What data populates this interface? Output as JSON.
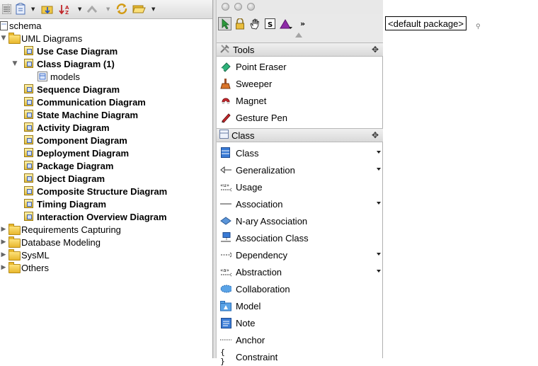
{
  "left_toolbar": {
    "icons": [
      "menu-icon",
      "refresh-diagram-icon",
      "folder-down-icon",
      "sort-az-icon",
      "up-arrow-icon",
      "sync-icon",
      "folder-open-icon"
    ]
  },
  "tree": {
    "root": "schema",
    "uml_folder": "UML Diagrams",
    "uml_children": [
      {
        "label": "Use Case Diagram"
      },
      {
        "label": "Class Diagram (1)"
      },
      {
        "label": "models"
      },
      {
        "label": "Sequence Diagram"
      },
      {
        "label": "Communication Diagram"
      },
      {
        "label": "State Machine Diagram"
      },
      {
        "label": "Activity Diagram"
      },
      {
        "label": "Component Diagram"
      },
      {
        "label": "Deployment Diagram"
      },
      {
        "label": "Package Diagram"
      },
      {
        "label": "Object Diagram"
      },
      {
        "label": "Composite Structure Diagram"
      },
      {
        "label": "Timing Diagram"
      },
      {
        "label": "Interaction Overview Diagram"
      }
    ],
    "folders": [
      "Requirements Capturing",
      "Database Modeling",
      "SysML",
      "Others"
    ]
  },
  "palette": {
    "toolbar_icons": [
      "select-arrow-icon",
      "lock-icon",
      "hand-icon",
      "s-icon",
      "triangle-icon",
      "expand-chevron-icon"
    ],
    "tools_section": {
      "title": "Tools",
      "items": [
        "Point Eraser",
        "Sweeper",
        "Magnet",
        "Gesture Pen"
      ]
    },
    "class_section": {
      "title": "Class",
      "items": [
        {
          "label": "Class",
          "dropdown": true
        },
        {
          "label": "Generalization",
          "dropdown": true
        },
        {
          "label": "Usage",
          "dropdown": false
        },
        {
          "label": "Association",
          "dropdown": true
        },
        {
          "label": "N-ary Association",
          "dropdown": false
        },
        {
          "label": "Association Class",
          "dropdown": false
        },
        {
          "label": "Dependency",
          "dropdown": true
        },
        {
          "label": "Abstraction",
          "dropdown": true
        },
        {
          "label": "Collaboration",
          "dropdown": false
        },
        {
          "label": "Model",
          "dropdown": false
        },
        {
          "label": "Note",
          "dropdown": false
        },
        {
          "label": "Anchor",
          "dropdown": false
        },
        {
          "label": "Constraint",
          "dropdown": false
        }
      ]
    }
  },
  "canvas": {
    "package_label": "<default package>"
  },
  "colors": {
    "folder": "#f0c948",
    "class_blue": "#3a7bd5",
    "abstraction_purple": "#8e2aa8"
  }
}
